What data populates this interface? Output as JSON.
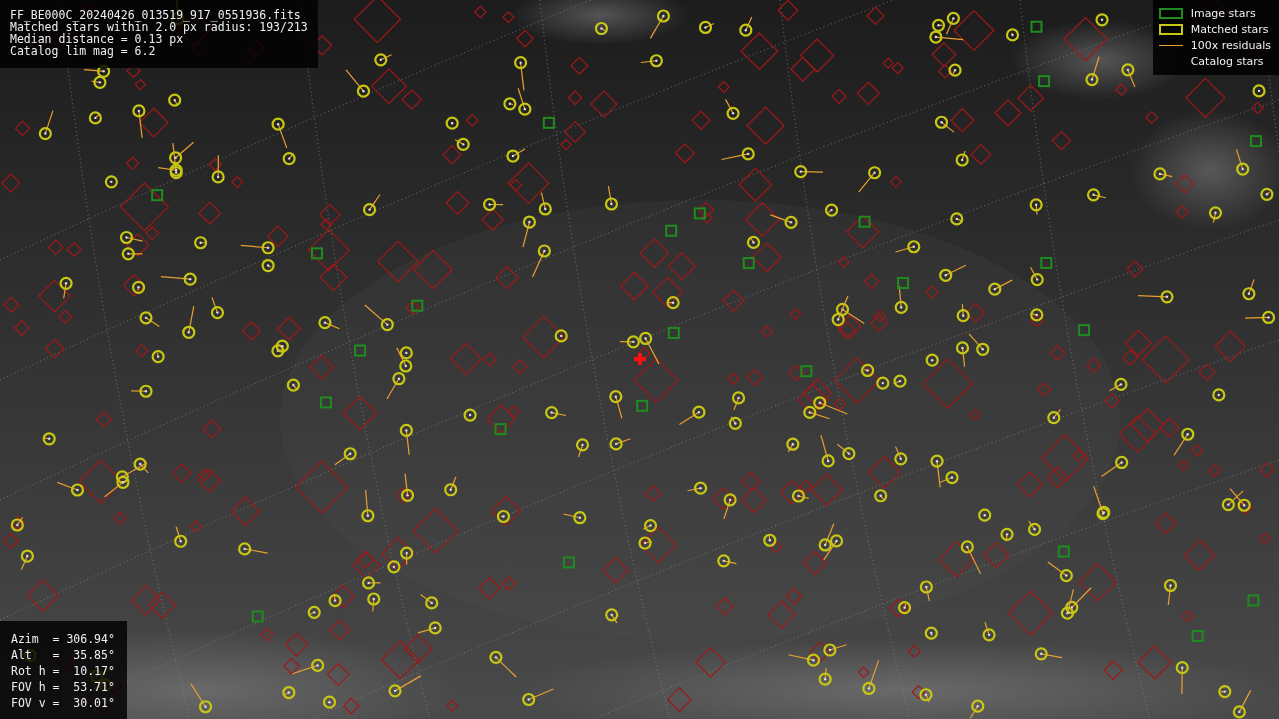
{
  "info_panel": {
    "lines": [
      "FF_BE000C_20240426_013519_917_0551936.fits",
      "Matched stars within 2.0 px radius: 193/213",
      "Median distance = 0.13 px",
      "Catalog lim mag = 6.2"
    ]
  },
  "legend": [
    {
      "label": "Image stars",
      "kind": "box",
      "color": "#1e8c1e"
    },
    {
      "label": "Matched stars",
      "kind": "box",
      "color": "#c8c814"
    },
    {
      "label": "100x residuals",
      "kind": "line",
      "color": "#e8a030"
    },
    {
      "label": "Catalog stars",
      "kind": "none"
    }
  ],
  "pointing_panel": {
    "lines": [
      "Azim  = 306.94°",
      "Alt   =  35.85°",
      "Rot h =  10.17°",
      "FOV h =  53.71°",
      "FOV v =  30.01°"
    ]
  }
}
